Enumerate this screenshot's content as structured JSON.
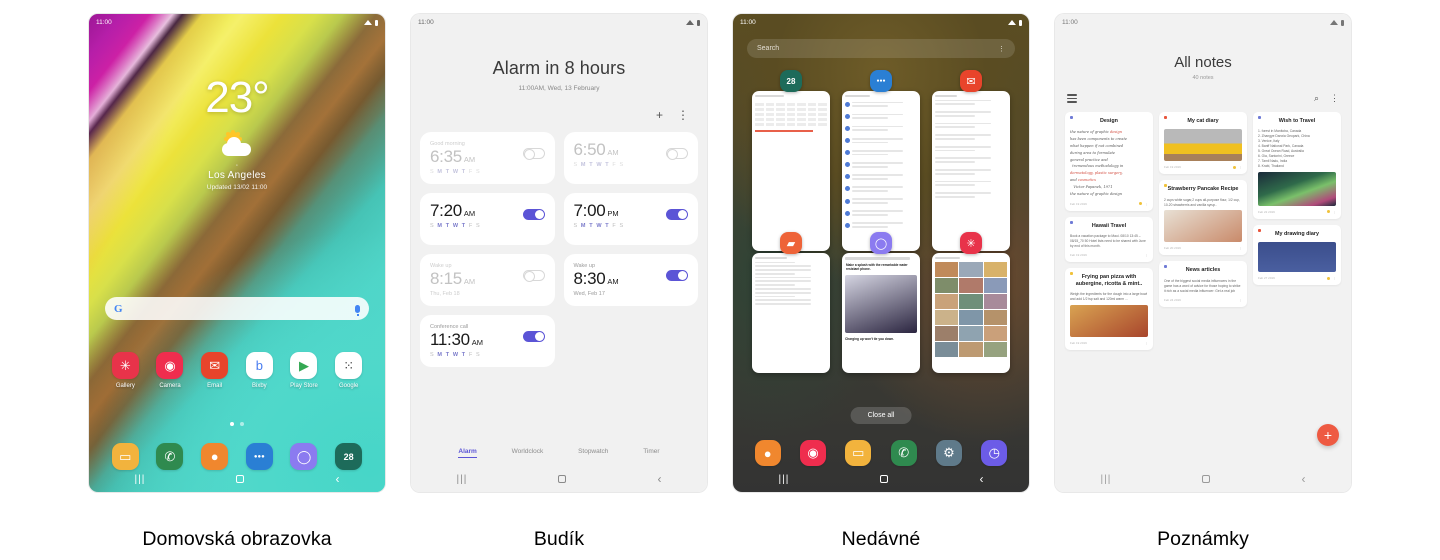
{
  "panels": [
    {
      "caption": "Domovská obrazovka"
    },
    {
      "caption": "Budík"
    },
    {
      "caption": "Nedávné"
    },
    {
      "caption": "Poznámky"
    }
  ],
  "status_bar": {
    "time": "11:00",
    "wifi_icon": "wifi-icon",
    "battery_icon": "battery-icon"
  },
  "nav_bar": {
    "recents_icon": "recents-icon",
    "home_icon": "home-icon",
    "back_icon": "back-icon"
  },
  "home": {
    "temperature": "23°",
    "weather_icon": "partly-cloudy-icon",
    "location_pin_icon": "location-pin-icon",
    "city": "Los Angeles",
    "updated": "Updated 13/02 11:00",
    "search": {
      "logo": "G",
      "placeholder": "",
      "mic_icon": "microphone-icon"
    },
    "apps": [
      {
        "label": "Gallery",
        "glyph": "✳",
        "color": "#e8334a"
      },
      {
        "label": "Camera",
        "glyph": "◉",
        "color": "#ef2d4e"
      },
      {
        "label": "Email",
        "glyph": "✉",
        "color": "#e8442b"
      },
      {
        "label": "Bixby",
        "glyph": "b",
        "color": "#ffffff"
      },
      {
        "label": "Play Store",
        "glyph": "▶",
        "color": "#ffffff"
      },
      {
        "label": "Google",
        "glyph": "⁙",
        "color": "#ffffff"
      }
    ],
    "page_dots": {
      "count": 2,
      "active": 0
    },
    "dock": [
      {
        "label": "My Files",
        "glyph": "▭",
        "color": "#f2b33d"
      },
      {
        "label": "Phone",
        "glyph": "✆",
        "color": "#2f8a4f"
      },
      {
        "label": "Contacts",
        "glyph": "●",
        "color": "#f0872e"
      },
      {
        "label": "Messages",
        "glyph": "●●●",
        "color": "#2a7fd4"
      },
      {
        "label": "Internet",
        "glyph": "◯",
        "color": "#8b7bf0"
      },
      {
        "label": "Calendar",
        "glyph": "28",
        "color": "#1d6b5a"
      }
    ]
  },
  "alarm": {
    "title": "Alarm in 8 hours",
    "subtitle": "11:00AM, Wed, 13 February",
    "add_icon": "plus-icon",
    "more_icon": "more-vertical-icon",
    "day_letters": "S M T W T F S",
    "alarms": [
      {
        "label": "Good morning",
        "time": "6:35",
        "meridiem": "AM",
        "days": "S M T W T F S",
        "date": "",
        "on": false
      },
      {
        "label": "",
        "time": "6:50",
        "meridiem": "AM",
        "days": "S M T W T F S",
        "date": "",
        "on": false
      },
      {
        "label": "",
        "time": "7:20",
        "meridiem": "AM",
        "days": "S M T W T F S",
        "date": "",
        "on": true
      },
      {
        "label": "",
        "time": "7:00",
        "meridiem": "PM",
        "days": "S M T W T F S",
        "date": "",
        "on": true
      },
      {
        "label": "Wake up",
        "time": "8:15",
        "meridiem": "AM",
        "days": "",
        "date": "Thu, Feb 18",
        "on": false
      },
      {
        "label": "Wake up",
        "time": "8:30",
        "meridiem": "AM",
        "days": "",
        "date": "Wed, Feb 17",
        "on": true
      },
      {
        "label": "Conference call",
        "time": "11:30",
        "meridiem": "AM",
        "days": "S M T W T F S",
        "date": "",
        "on": true
      }
    ],
    "tabs": [
      {
        "label": "Alarm",
        "active": true
      },
      {
        "label": "Worldclock",
        "active": false
      },
      {
        "label": "Stopwatch",
        "active": false
      },
      {
        "label": "Timer",
        "active": false
      }
    ]
  },
  "recents": {
    "search_placeholder": "Search",
    "more_icon": "more-vertical-icon",
    "close_all_label": "Close all",
    "cards": [
      {
        "app": "Calendar",
        "glyph": "28",
        "color": "#1d6b5a"
      },
      {
        "app": "Messages",
        "glyph": "●●●",
        "color": "#2a7fd4"
      },
      {
        "app": "Email",
        "glyph": "✉",
        "color": "#e8442b"
      },
      {
        "app": "Samsung Notes",
        "glyph": "▰",
        "color": "#ee6338"
      },
      {
        "app": "Internet",
        "glyph": "◯",
        "color": "#8b7bf0"
      },
      {
        "app": "Gallery",
        "glyph": "✳",
        "color": "#e8334a"
      }
    ],
    "internet_card": {
      "headline": "Make a splash with the remarkable water resistant phone.",
      "footer": "Charging up won't tie you down."
    },
    "dock": [
      {
        "label": "Contacts",
        "glyph": "●",
        "color": "#f0872e"
      },
      {
        "label": "Camera",
        "glyph": "◉",
        "color": "#ef2d4e"
      },
      {
        "label": "My Files",
        "glyph": "▭",
        "color": "#f2b33d"
      },
      {
        "label": "Phone",
        "glyph": "✆",
        "color": "#2f8a4f"
      },
      {
        "label": "Settings",
        "glyph": "⚙",
        "color": "#5f7a8a"
      },
      {
        "label": "Clock",
        "glyph": "◷",
        "color": "#6c5ce7"
      }
    ]
  },
  "notes": {
    "title": "All notes",
    "count": "40 notes",
    "menu_icon": "hamburger-icon",
    "search_icon": "search-icon",
    "more_icon": "more-vertical-icon",
    "fab_icon": "plus-icon",
    "fab_color": "#ee5a42",
    "columns": [
      [
        {
          "title": "Design",
          "kind": "handwriting",
          "date": "Feb 19 2019",
          "dot": "#6f7bd6",
          "pinned": true
        },
        {
          "title": "Hawaii Travel",
          "kind": "text",
          "date": "Feb 19 2019",
          "dot": "#6f7bd6",
          "body": "Book a vacation package to Maui. 08/10 13:45 – 08/15_70 50 Hotel lists need to be shared with June by end of this month."
        },
        {
          "title": "Frying pan pizza with aubergine, ricotta & mint..",
          "kind": "image-text",
          "date": "Feb 19 2019",
          "dot": "#f0c23a",
          "body": "Weigh the ingredients for the dough into a large bowl and add 1/2 tsp salt and 120ml warm ..."
        }
      ],
      [
        {
          "title": "My cat diary",
          "kind": "image",
          "date": "Feb 19 2019",
          "dot": "#e8553c",
          "pinned": true
        },
        {
          "title": "Strawberry Pancake Recipe",
          "kind": "image-text",
          "date": "Feb 20 2019",
          "dot": "#f0c23a",
          "body": "2 cups white sugar,2 cups all-purpose flour, 1/2 cup, 10-20 strawberris and vanilla syrup.."
        },
        {
          "title": "News articles",
          "kind": "text",
          "date": "Feb 24 2019",
          "dot": "#6f7bd6",
          "body": "One of the biggest social media influencers in the game has a word of advice for those hoping to strike it rich as a social media influencer: Get a real job"
        }
      ],
      [
        {
          "title": "Wish to Travel",
          "kind": "list-image",
          "date": "Feb 22 2019",
          "dot": "#6f7bd6",
          "pinned": true,
          "list": [
            "1. forest in Manitoba, Canada",
            "2. Zhangye Danxia Geopark, China",
            "3. Venice, Italy",
            "4. Banff National Park, Canada",
            "5. Great Ocean Road, Australia",
            "6. Oia, Santorini, Greece",
            "7. Tamil Nadu, India",
            "8. Krabi, Thailand"
          ]
        },
        {
          "title": "My drawing diary",
          "kind": "image",
          "date": "Feb 27 2019",
          "dot": "#e8553c",
          "pinned": true
        }
      ]
    ]
  }
}
